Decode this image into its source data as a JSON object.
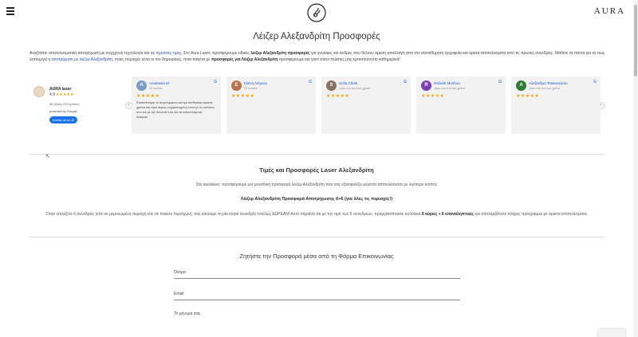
{
  "header": {
    "brand": "AURA"
  },
  "page": {
    "title": "Λέιζερ Αλεξανδρίτη Προσφορές"
  },
  "intro": {
    "part1": "Αναζητάτε αποτελεσματική αποτρίχωση με σύγχρονη τεχνολογία και σε ",
    "link1": "προσιτές τιμές",
    "part2": "; Στο Aura Laser, προσφέρουμε ειδικές ",
    "bold1": "λέιζερ Αλεξανδρίτη προσφορές",
    "part3": " για γυναίκες και άνδρες που θέλουν άμεση απαλλαγή από την ανεπιθύμητη τριχοφυΐα και ορατά αποτελέσματα από τις πρώτες συνεδρίες. Μάθετε τα πάντα για το πώς λειτουργεί η ",
    "link2": "αποτρίχωση με λέιζερ Αλεξανδρίτη",
    "part4": ", ποιες περιοχές είναι οι πιο δημοφιλείς, ποια πακέτα με ",
    "bold2": "προσφορές για Λέιζερ Αλεξανδρίτη",
    "part5": " προσφέρουμε και γιατί τόσοι πελάτες μας εμπιστεύονται καθημερινά!"
  },
  "rating": {
    "name": "AURA laser",
    "score": "4.9",
    "stars": "★★★★★",
    "based_on": "Με βάση 222 κριτικές",
    "powered": "powered by Google",
    "button": "review us on"
  },
  "reviews": [
    {
      "name": "Anastasia M",
      "date": "10 months",
      "initial": "A",
      "color": "#7a9cc6",
      "stars": "★★★★★",
      "text": "Επισκέπτομαι το συγκεκριμένο κέντρο αισθητικής αρκετά χρόνια και είμαι άκρως ευχαριστημένη τόσο με τις κοπέλες όσο και με την δουλειά τους και τα αποτελέσματα. Δοκίμασ"
    },
    {
      "name": "Ελένη Λιόγκου",
      "date": "10 months",
      "initial": "Ε",
      "color": "#b8734a",
      "stars": "★★★★★",
      "text": ""
    },
    {
      "name": "Sofia Chiati",
      "date": "γύρω στο ένα έτος χρόνο",
      "initial": "S",
      "color": "#8a6f5e",
      "stars": "★★★★★",
      "text": ""
    },
    {
      "name": "Rafaela Moshou",
      "date": "γύρω στο ένα έτος χρόνο",
      "initial": "R",
      "color": "#7b3fb0",
      "stars": "★★★★★",
      "text": ""
    },
    {
      "name": "Αλεξάνδρα Τσακονιώτου",
      "date": "γύρω στο ένα έτος χρόνο",
      "initial": "A",
      "color": "#2e7d32",
      "stars": "★★★★★",
      "text": ""
    }
  ],
  "offers": {
    "title": "Τιμές και Προσφορές Laser Αλεξανδρίτη",
    "subtitle": "Στο auralaser, προσφέρουμε μια μοναδική προσφορά λέιζερ Αλεξανδρίτη που σας εξασφαλίζει μέγιστα αποτελέσματα με λιγότερο κόστος",
    "offer_title": "Λέιζερ Αλεξανδρίτη Προσφορά Αποτρίχωσης 6+6 (για όλες τις περιοχές!)",
    "body1": "Όταν επιλέξετε 6 συνεδρίες (είτε σε μεμονωμένη περιοχή είτε σε πακέτο περιοχών), σας κάνουμε τη μία κύρια συνεδρία εντελώς ΔΩΡΕΑΝ! Αυτό σημαίνει ότι με την τιμή των 5 συνεδριών, πραγματοποιείτε συνολικά ",
    "bold": "6 κύριες + 6 επαναληπτικές",
    "body2": " και απολαμβάνετε πλήρες πρόγραμμα με άριστα αποτελέσματα."
  },
  "form": {
    "title": "Ζητήστε την Προσφορά μέσα από τη Φόρμα Επικοινωνίας",
    "name_label": "Όνομα",
    "email_label": "Email",
    "message_label": "Το μήνυμά σας"
  }
}
